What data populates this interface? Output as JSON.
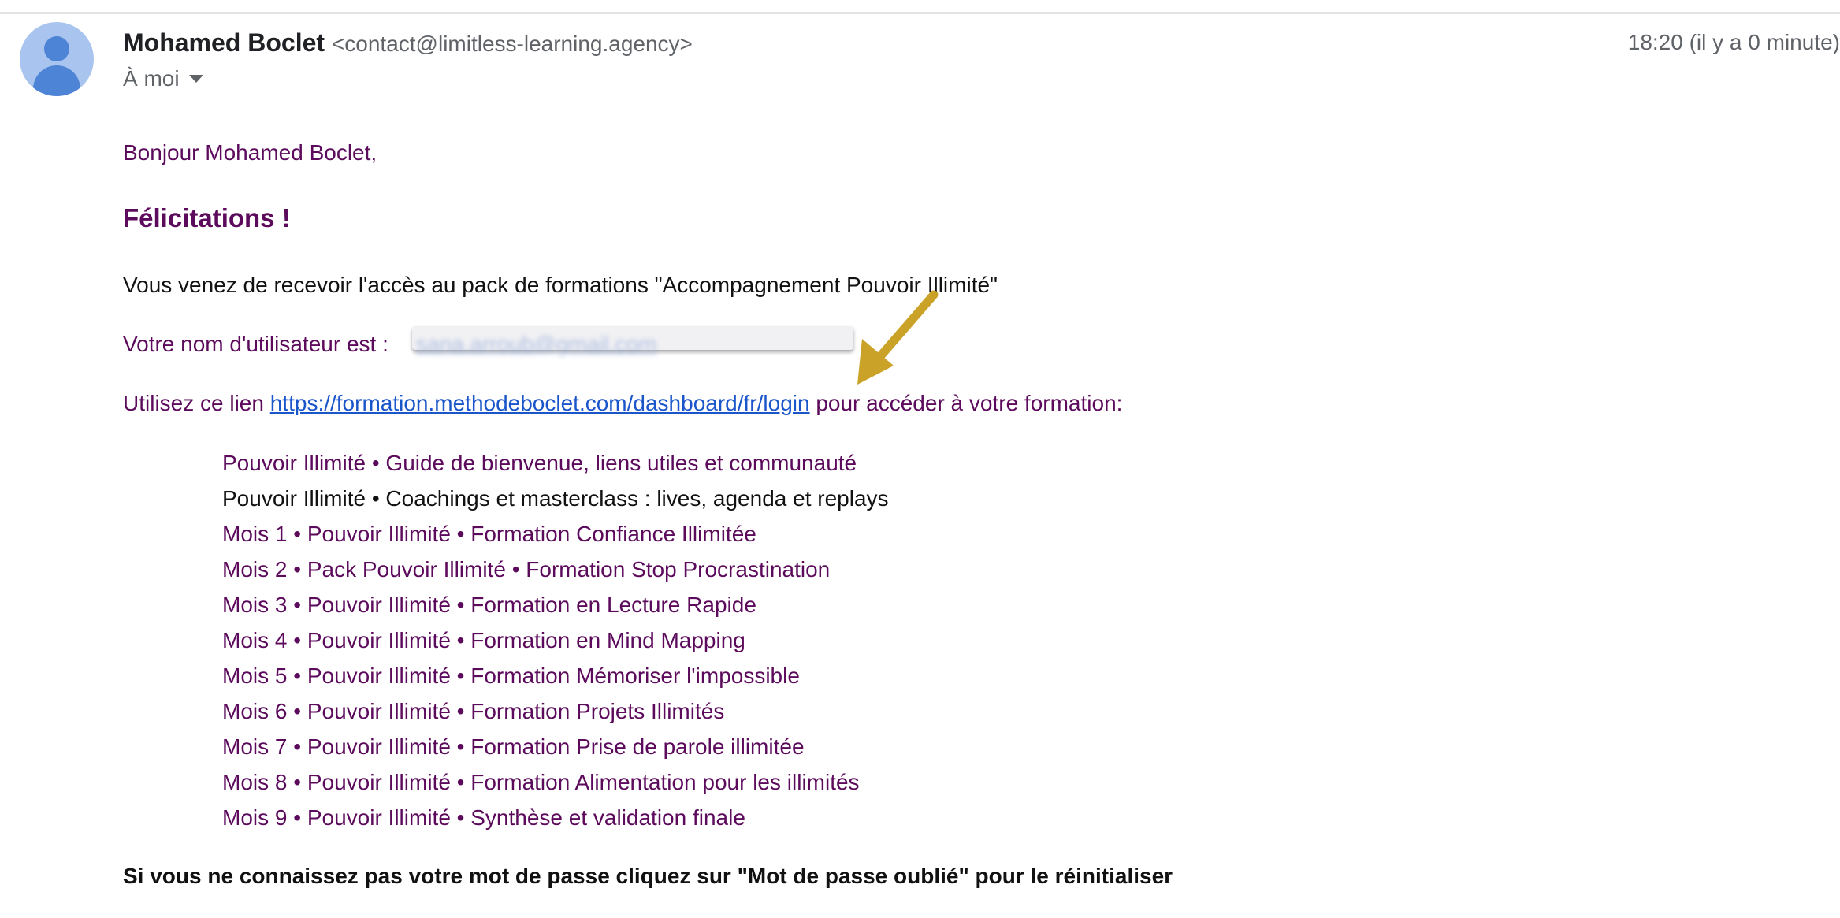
{
  "sender": {
    "name": "Mohamed Boclet",
    "email": "<contact@limitless-learning.agency>",
    "recipient_label": "À moi",
    "timestamp": "18:20 (il y a 0 minute)"
  },
  "body": {
    "greeting": "Bonjour Mohamed Boclet,",
    "heading": "Félicitations !",
    "intro": "Vous venez de recevoir l'accès au pack de formations \"Accompagnement Pouvoir Illimité\"",
    "username_label": "Votre nom d'utilisateur est :",
    "username_value": "sana.arroub@gmail.com",
    "link_prefix": "Utilisez ce lien",
    "link_url": "https://formation.methodeboclet.com/dashboard/fr/login",
    "link_suffix": "pour accéder à votre formation:",
    "courses": [
      "Pouvoir Illimité • Guide de bienvenue, liens utiles et communauté",
      "Pouvoir Illimité • Coachings et masterclass : lives, agenda et replays",
      "Mois 1 • Pouvoir Illimité • Formation Confiance Illimitée",
      "Mois 2 • Pack Pouvoir Illimité • Formation Stop Procrastination",
      "Mois 3 • Pouvoir Illimité • Formation en Lecture Rapide",
      "Mois 4 • Pouvoir Illimité • Formation en Mind Mapping",
      "Mois 5 • Pouvoir Illimité • Formation Mémoriser l'impossible",
      "Mois 6 • Pouvoir Illimité • Formation Projets Illimités",
      "Mois 7 • Pouvoir Illimité • Formation Prise de parole illimitée",
      "Mois 8 • Pouvoir Illimité • Formation Alimentation pour les illimités",
      "Mois 9 • Pouvoir Illimité • Synthèse et validation finale"
    ],
    "password_note": "Si vous ne connaissez pas votre mot de passe cliquez sur \"Mot de passe oublié\" pour le réinitialiser"
  },
  "icons": {
    "avatar": "person-avatar-icon",
    "recipient_dropdown": "chevron-down-icon",
    "annotation": "arrow-annotation"
  },
  "colors": {
    "purple_text": "#5c0a5c",
    "link_blue": "#1a55c9",
    "arrow_gold": "#c9a227",
    "avatar_bg": "#a8c4ef",
    "avatar_fg": "#4e84d6"
  }
}
